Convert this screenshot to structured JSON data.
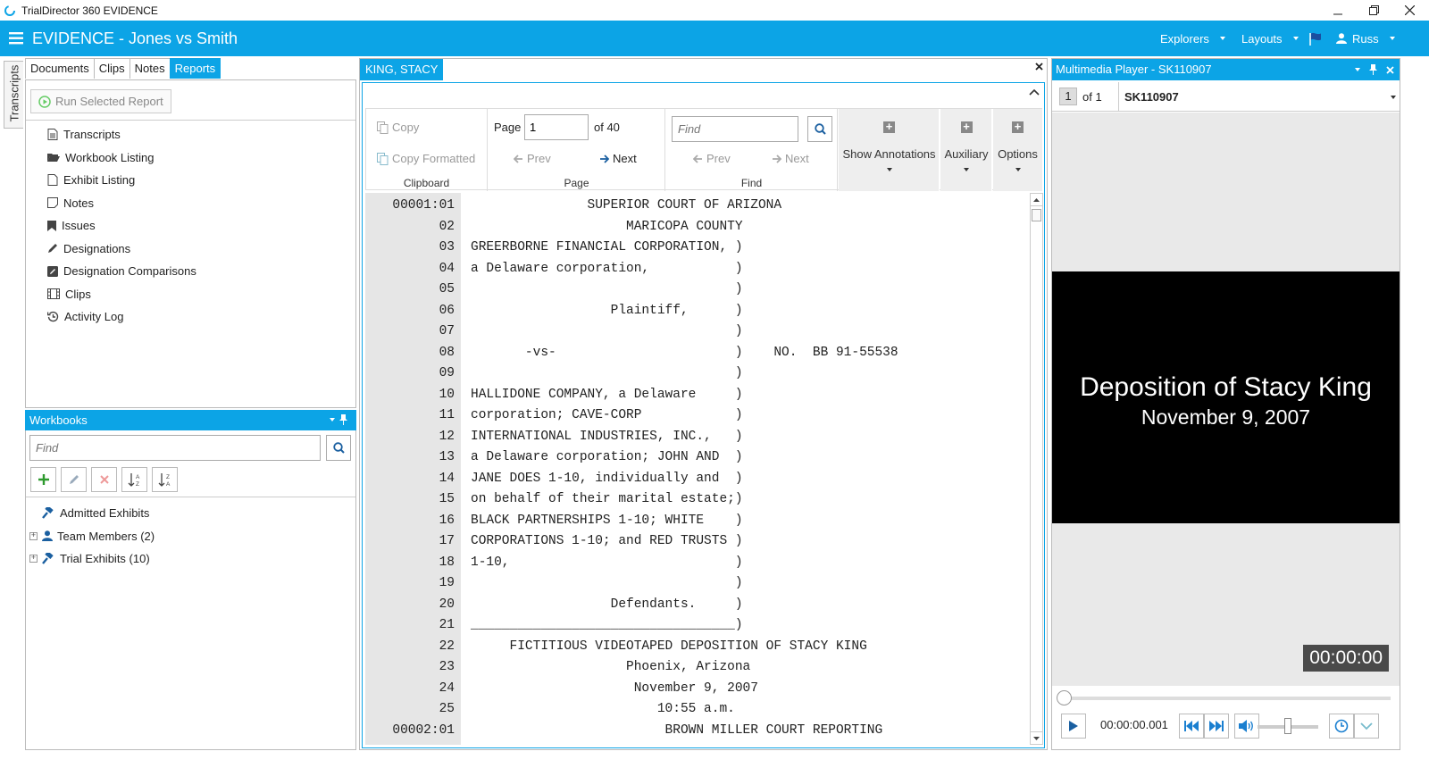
{
  "window": {
    "title": "TrialDirector 360 EVIDENCE"
  },
  "appbar": {
    "title": "EVIDENCE - Jones vs Smith",
    "explorers": "Explorers",
    "layouts": "Layouts",
    "user": "Russ"
  },
  "sidetab": {
    "label": "Transcripts"
  },
  "lefttabs": [
    "Documents",
    "Clips",
    "Notes",
    "Reports"
  ],
  "reports": {
    "run_label": "Run Selected Report",
    "items": [
      "Transcripts",
      "Workbook Listing",
      "Exhibit Listing",
      "Notes",
      "Issues",
      "Designations",
      "Designation Comparisons",
      "Clips",
      "Activity Log"
    ]
  },
  "workbooks": {
    "title": "Workbooks",
    "find_placeholder": "Find",
    "items": [
      "Admitted Exhibits",
      "Team Members (2)",
      "Trial Exhibits (10)"
    ]
  },
  "transcript": {
    "tab": "KING, STACY",
    "ribbon": {
      "copy": "Copy",
      "copy_formatted": "Copy Formatted",
      "clipboard": "Clipboard",
      "page_label": "Page",
      "page_value": "1",
      "of_pages": "of 40",
      "prev": "Prev",
      "next": "Next",
      "page_group": "Page",
      "find_placeholder": "Find",
      "find_prev": "Prev",
      "find_next": "Next",
      "find_group": "Find",
      "show_annotations": "Show Annotations",
      "auxiliary": "Auxiliary",
      "options": "Options"
    },
    "lines": [
      {
        "n": "00001:01",
        "t": "               SUPERIOR COURT OF ARIZONA"
      },
      {
        "n": "02",
        "t": "                    MARICOPA COUNTY"
      },
      {
        "n": "03",
        "t": "GREERBORNE FINANCIAL CORPORATION, )"
      },
      {
        "n": "04",
        "t": "a Delaware corporation,           )"
      },
      {
        "n": "05",
        "t": "                                  )"
      },
      {
        "n": "06",
        "t": "                  Plaintiff,      )"
      },
      {
        "n": "07",
        "t": "                                  )"
      },
      {
        "n": "08",
        "t": "       -vs-                       )    NO.  BB 91-55538"
      },
      {
        "n": "09",
        "t": "                                  )"
      },
      {
        "n": "10",
        "t": "HALLIDONE COMPANY, a Delaware     )"
      },
      {
        "n": "11",
        "t": "corporation; CAVE-CORP            )"
      },
      {
        "n": "12",
        "t": "INTERNATIONAL INDUSTRIES, INC.,   )"
      },
      {
        "n": "13",
        "t": "a Delaware corporation; JOHN AND  )"
      },
      {
        "n": "14",
        "t": "JANE DOES 1-10, individually and  )"
      },
      {
        "n": "15",
        "t": "on behalf of their marital estate;)"
      },
      {
        "n": "16",
        "t": "BLACK PARTNERSHIPS 1-10; WHITE    )"
      },
      {
        "n": "17",
        "t": "CORPORATIONS 1-10; and RED TRUSTS )"
      },
      {
        "n": "18",
        "t": "1-10,                             )"
      },
      {
        "n": "19",
        "t": "                                  )"
      },
      {
        "n": "20",
        "t": "                  Defendants.     )"
      },
      {
        "n": "21",
        "t": "__________________________________)"
      },
      {
        "n": "22",
        "t": "     FICTITIOUS VIDEOTAPED DEPOSITION OF STACY KING"
      },
      {
        "n": "23",
        "t": "                    Phoenix, Arizona"
      },
      {
        "n": "24",
        "t": "                     November 9, 2007"
      },
      {
        "n": "25",
        "t": "                        10:55 a.m."
      },
      {
        "n": "00002:01",
        "t": "                         BROWN MILLER COURT REPORTING"
      }
    ]
  },
  "player": {
    "title": "Multimedia Player - SK110907",
    "index": "1",
    "of": "of 1",
    "clip": "SK110907",
    "video_line1": "Deposition of Stacy King",
    "video_line2": "November 9, 2007",
    "timecode": "00:00:00",
    "time": "00:00:00.001"
  }
}
